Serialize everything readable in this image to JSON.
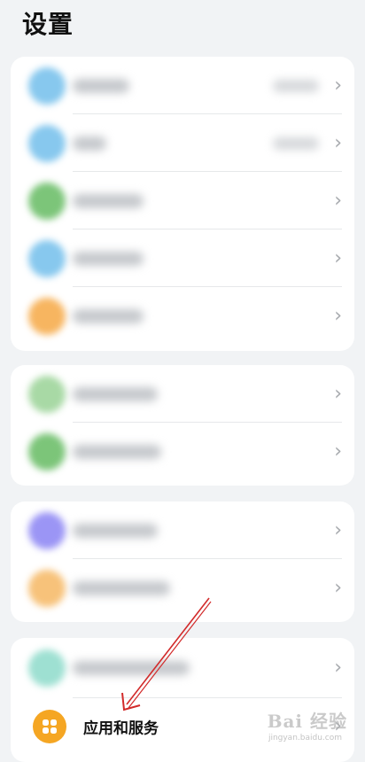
{
  "page": {
    "title": "设置"
  },
  "rows": {
    "app_services": {
      "label": "应用和服务",
      "icon": "apps-grid-icon",
      "icon_color": "#f5a623"
    }
  },
  "blurred_icon_colors": {
    "row1": "#87c8ee",
    "row2": "#87c8ee",
    "row3": "#7cc579",
    "row4": "#87c8ee",
    "row5": "#f7b560",
    "row6": "#a8d9a5",
    "row7": "#7cc579",
    "row8": "#9b95f5",
    "row9": "#f7c27a",
    "row10": "#9ee0d2"
  },
  "chevron": "›",
  "watermark": {
    "brand": "Bai 经验",
    "url": "jingyan.baidu.com"
  }
}
